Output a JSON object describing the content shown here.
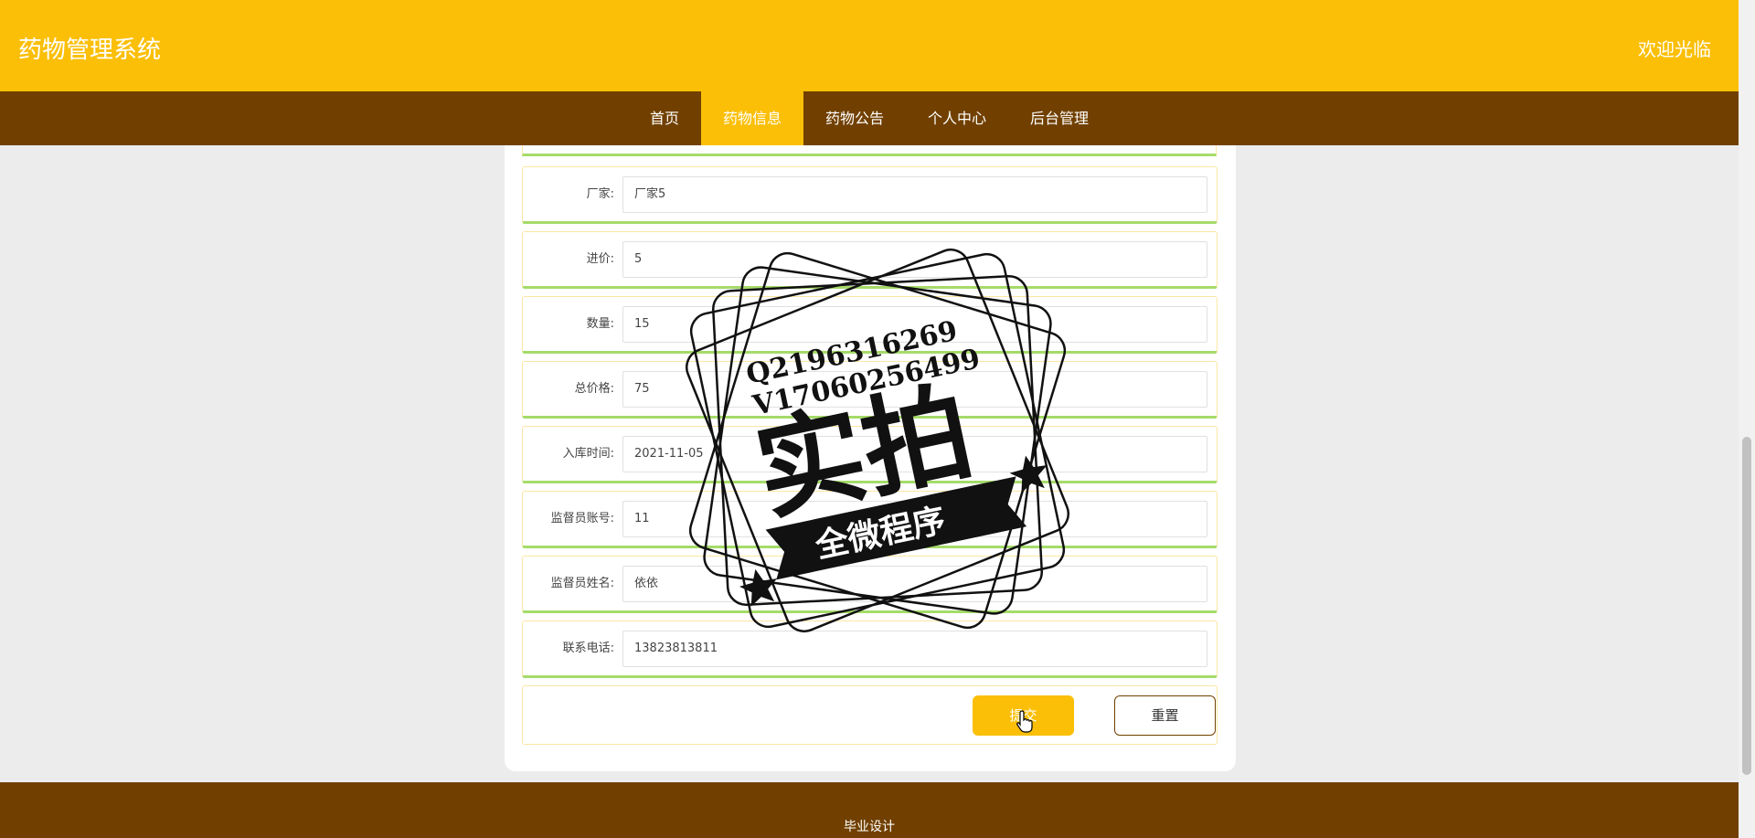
{
  "header": {
    "title": "药物管理系统",
    "welcome": "欢迎光临"
  },
  "nav": {
    "items": [
      {
        "label": "首页"
      },
      {
        "label": "药物信息"
      },
      {
        "label": "药物公告"
      },
      {
        "label": "个人中心"
      },
      {
        "label": "后台管理"
      }
    ],
    "active_index": 1
  },
  "form": {
    "fields": [
      {
        "label": "厂家:",
        "value": "厂家5"
      },
      {
        "label": "进价:",
        "value": "5"
      },
      {
        "label": "数量:",
        "value": "15"
      },
      {
        "label": "总价格:",
        "value": "75"
      },
      {
        "label": "入库时间:",
        "value": "2021-11-05"
      },
      {
        "label": "监督员账号:",
        "value": "11"
      },
      {
        "label": "监督员姓名:",
        "value": "依依"
      },
      {
        "label": "联系电话:",
        "value": "13823813811"
      }
    ],
    "submit_label": "提交",
    "reset_label": "重置"
  },
  "watermark": {
    "line1": "Q2196316269",
    "line2": "V17060256499",
    "big": "实拍",
    "banner": "全微程序"
  },
  "footer": {
    "text": "毕业设计"
  },
  "colors": {
    "accent": "#fbbf07",
    "brown": "#714000",
    "green": "#a5db69"
  }
}
